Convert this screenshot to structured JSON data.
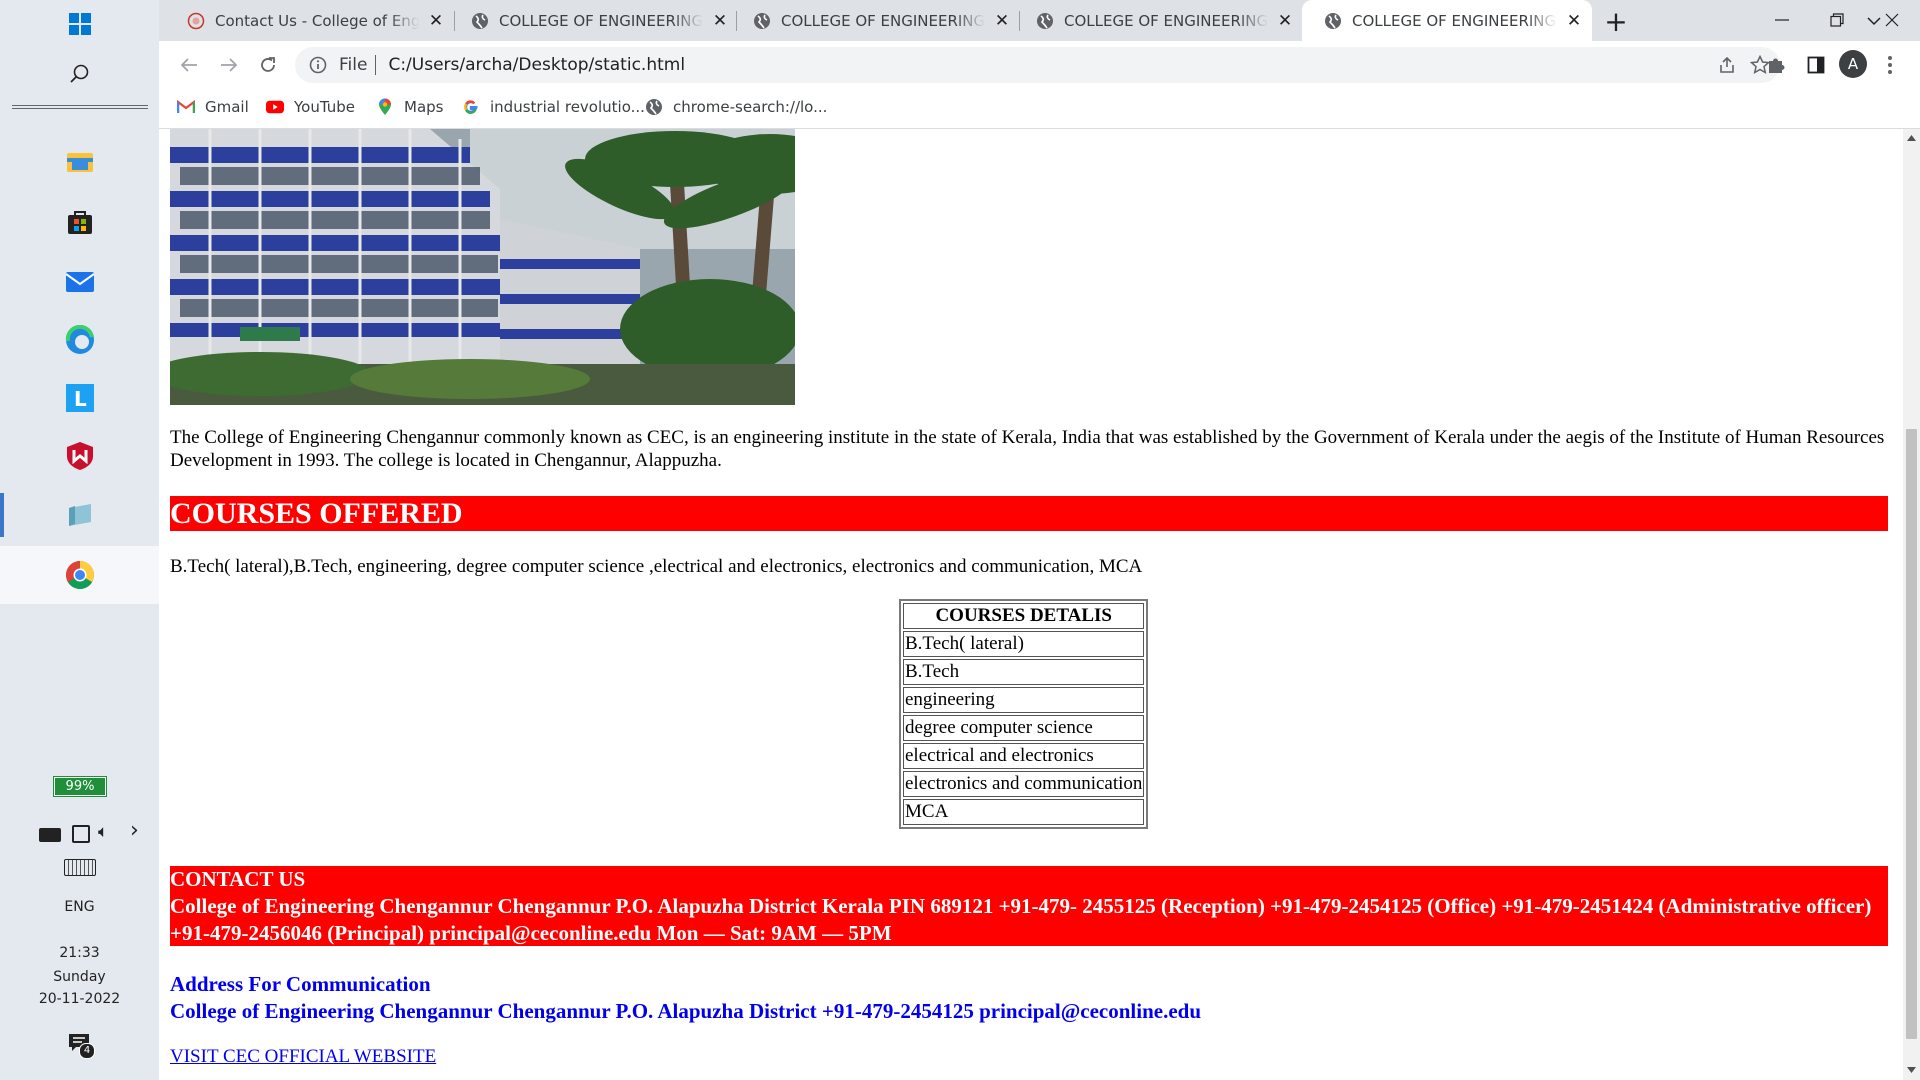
{
  "taskbar": {
    "battery": "99%",
    "language": "ENG",
    "time": "21:33",
    "day": "Sunday",
    "date": "20-11-2022",
    "notification_count": "4"
  },
  "browser": {
    "tabs": [
      {
        "title": "Contact Us - College of Engineering Chengannur",
        "close": "✕"
      },
      {
        "title": "COLLEGE OF ENGINEERING CHENGANNUR",
        "close": "✕"
      },
      {
        "title": "COLLEGE OF ENGINEERING CHENGANNUR",
        "close": "✕"
      },
      {
        "title": "COLLEGE OF ENGINEERING CHENGANNUR",
        "close": "✕"
      },
      {
        "title": "COLLEGE OF ENGINEERING CHENGANNUR",
        "close": "✕"
      }
    ],
    "new_tab": "+",
    "address": {
      "scheme_label": "File",
      "url": "C:/Users/archa/Desktop/static.html"
    },
    "profile_initial": "A",
    "bookmarks": [
      {
        "label": "Gmail",
        "icon": "gmail-icon"
      },
      {
        "label": "YouTube",
        "icon": "youtube-icon"
      },
      {
        "label": "Maps",
        "icon": "maps-icon"
      },
      {
        "label": "industrial revolutio...",
        "icon": "google-icon"
      },
      {
        "label": "chrome-search://lo...",
        "icon": "globe-icon"
      }
    ]
  },
  "page": {
    "description": "The College of Engineering Chengannur commonly known as CEC, is an engineering institute in the state of Kerala, India that was established by the Government of Kerala under the aegis of the Institute of Human Resources Development in 1993. The college is located in Chengannur, Alappuzha.",
    "courses_heading": "COURSES OFFERED",
    "courses_line": "B.Tech( lateral),B.Tech, engineering, degree computer science ,electrical and electronics, electronics and communication, MCA",
    "courses_table": {
      "header": "COURSES DETALIS",
      "rows": [
        "B.Tech( lateral)",
        "B.Tech",
        "engineering",
        "degree computer science",
        "electrical and electronics",
        "electronics and communication",
        "MCA"
      ]
    },
    "contact": {
      "heading": "CONTACT US",
      "text": "College of Engineering Chengannur Chengannur P.O. Alapuzha District Kerala PIN 689121 +91-479- 2455125 (Reception) +91-479-2454125 (Office) +91-479-2451424 (Administrative officer) +91-479-2456046 (Principal) principal@ceconline.edu Mon — Sat: 9AM — 5PM"
    },
    "address": {
      "heading": "Address For Communication",
      "text": "College of Engineering Chengannur Chengannur P.O. Alapuzha District +91-479-2454125 principal@ceconline.edu"
    },
    "visit_link": "VISIT CEC OFFICIAL WEBSITE"
  },
  "colors": {
    "heading_red": "#ff0000",
    "link_blue": "#0000ee",
    "tabstrip": "#dee1e6",
    "taskbar": "#e4e9ef"
  }
}
